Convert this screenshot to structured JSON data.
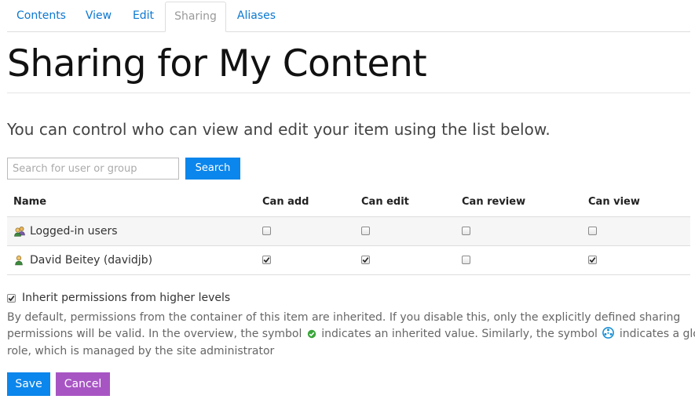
{
  "tabs": [
    {
      "label": "Contents",
      "active": false
    },
    {
      "label": "View",
      "active": false
    },
    {
      "label": "Edit",
      "active": false
    },
    {
      "label": "Sharing",
      "active": true
    },
    {
      "label": "Aliases",
      "active": false
    }
  ],
  "page_title": "Sharing for My Content",
  "intro": "You can control who can view and edit your item using the list below.",
  "search": {
    "placeholder": "Search for user or group",
    "value": "",
    "button_label": "Search"
  },
  "table": {
    "columns": [
      "Name",
      "Can add",
      "Can edit",
      "Can review",
      "Can view"
    ],
    "rows": [
      {
        "name": "Logged-in users",
        "icon": "group-icon",
        "can_add": false,
        "can_edit": false,
        "can_review": false,
        "can_view": false
      },
      {
        "name": "David Beitey (davidjb)",
        "icon": "user-icon",
        "can_add": true,
        "can_edit": true,
        "can_review": false,
        "can_view": true
      }
    ]
  },
  "inherit": {
    "checked": true,
    "label": "Inherit permissions from higher levels"
  },
  "help_lines": [
    "By default, permissions from the container of this item are inherited. If you disable this, only the explicitly defined sharing",
    "permissions will be valid. In the overview, the symbol",
    "indicates an inherited value. Similarly, the symbol",
    "indicates a global",
    "role, which is managed by the site administrator"
  ],
  "buttons": {
    "save_label": "Save",
    "cancel_label": "Cancel"
  },
  "colors": {
    "link": "#0b78d0",
    "primary_button": "#0b86ec",
    "cancel_button": "#a855c4",
    "inherited_symbol": "#3aa53a",
    "global_role_symbol": "#1a8fd6"
  }
}
